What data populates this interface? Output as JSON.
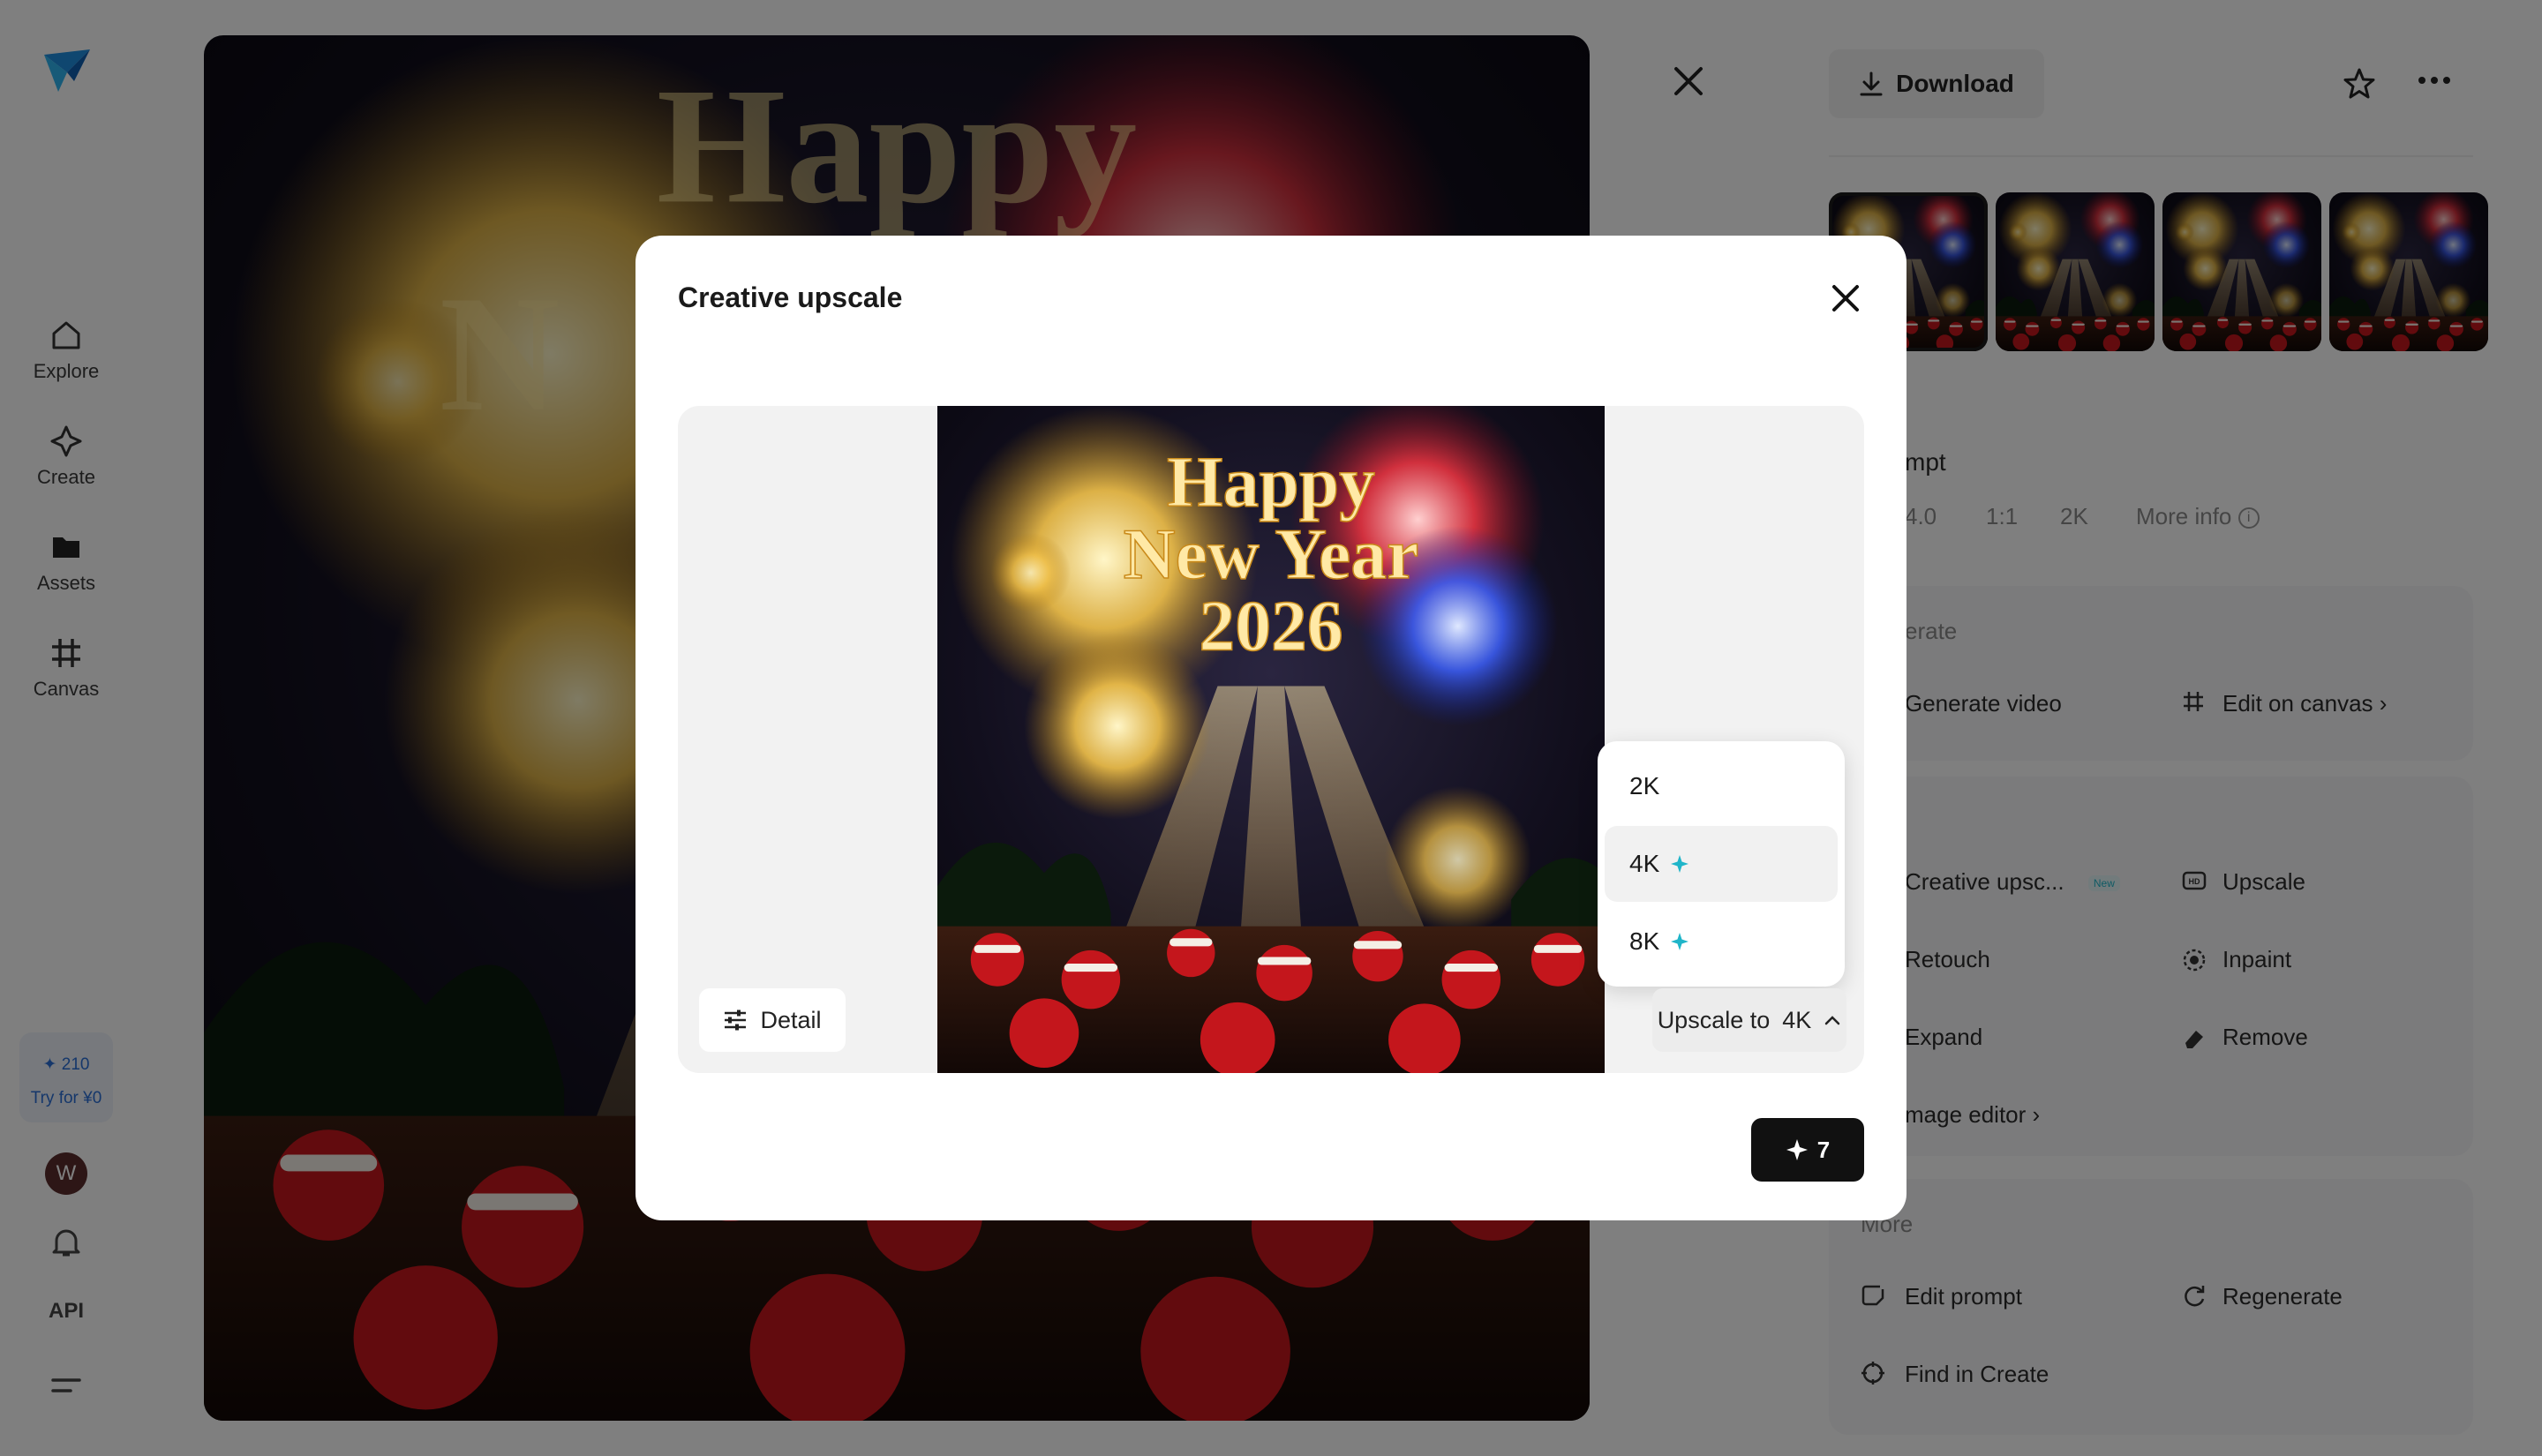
{
  "nav": {
    "items": [
      {
        "label": "Explore",
        "icon": "home-icon"
      },
      {
        "label": "Create",
        "icon": "sparkle-icon"
      },
      {
        "label": "Assets",
        "icon": "folder-icon"
      },
      {
        "label": "Canvas",
        "icon": "grid-icon"
      }
    ],
    "credits": "210",
    "try_label": "Try for ¥0",
    "avatar_initial": "W",
    "api_label": "API"
  },
  "image": {
    "line1": "Happy",
    "line2": "New Year",
    "line3": "2026"
  },
  "panel": {
    "download_label": "Download",
    "prompt_partial": "mpt",
    "meta": [
      "4.0",
      "1:1",
      "2K",
      "More info"
    ],
    "generate_header": "erate",
    "generate_video": "Generate video",
    "edit_on_canvas": "Edit on canvas",
    "tools": {
      "creative_upscale": "Creative upsc...",
      "new_badge": "New",
      "upscale": "Upscale",
      "retouch": "Retouch",
      "inpaint": "Inpaint",
      "expand": "Expand",
      "remove": "Remove",
      "image_editor": "mage editor"
    },
    "more_header": "More",
    "edit_prompt": "Edit prompt",
    "regenerate": "Regenerate",
    "find_in_create": "Find in Create"
  },
  "modal": {
    "title": "Creative upscale",
    "detail_label": "Detail",
    "upscale_prefix": "Upscale to",
    "upscale_value": "4K",
    "options": [
      {
        "label": "2K",
        "premium": false
      },
      {
        "label": "4K",
        "premium": true
      },
      {
        "label": "8K",
        "premium": true
      }
    ],
    "cost": "7"
  },
  "colors": {
    "accent_teal": "#1fb5c9",
    "credit_blue": "#2b6fd6",
    "submit_bg": "#111111"
  }
}
